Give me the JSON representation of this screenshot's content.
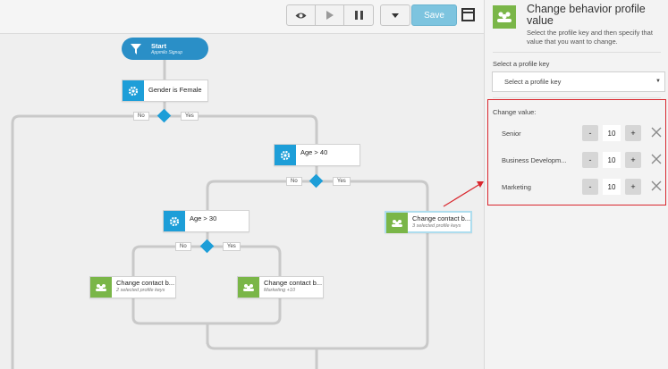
{
  "toolbar": {
    "buttons": [
      "eye-icon",
      "play-icon",
      "pause-icon",
      "caret-down-icon"
    ],
    "save_label": "Save"
  },
  "flow": {
    "start": {
      "title": "Start",
      "subtitle": "Appmilo Signup"
    },
    "nodes": {
      "gender": {
        "label": "Gender is Female",
        "icon": "gear-icon"
      },
      "age40": {
        "label": "Age > 40",
        "icon": "gear-icon"
      },
      "age30": {
        "label": "Age > 30",
        "icon": "gear-icon"
      },
      "contact_a": {
        "label": "Change contact b...",
        "sub": "3 selected profile keys",
        "icon": "people-icon"
      },
      "contact_b": {
        "label": "Change contact b...",
        "sub": "2 selected profile keys",
        "icon": "people-icon"
      },
      "contact_c": {
        "label": "Change contact b...",
        "sub": "Marketing +10",
        "icon": "people-icon"
      }
    },
    "branch_labels": {
      "no": "No",
      "yes": "Yes"
    }
  },
  "panel": {
    "title": "Change behavior profile value",
    "description": "Select the profile key and then specify that value that you want to change.",
    "select_label": "Select a profile key",
    "select_value": "Select a profile key",
    "change_label": "Change value:",
    "rows": [
      {
        "name": "Senior",
        "value": "10"
      },
      {
        "name": "Business Developm...",
        "value": "10"
      },
      {
        "name": "Marketing",
        "value": "10"
      }
    ],
    "minus": "-",
    "plus": "+"
  },
  "colors": {
    "accent_blue": "#1d9ed8",
    "green": "#7ab648",
    "highlight_red": "#d9262d",
    "save_blue": "#7dc4df"
  }
}
